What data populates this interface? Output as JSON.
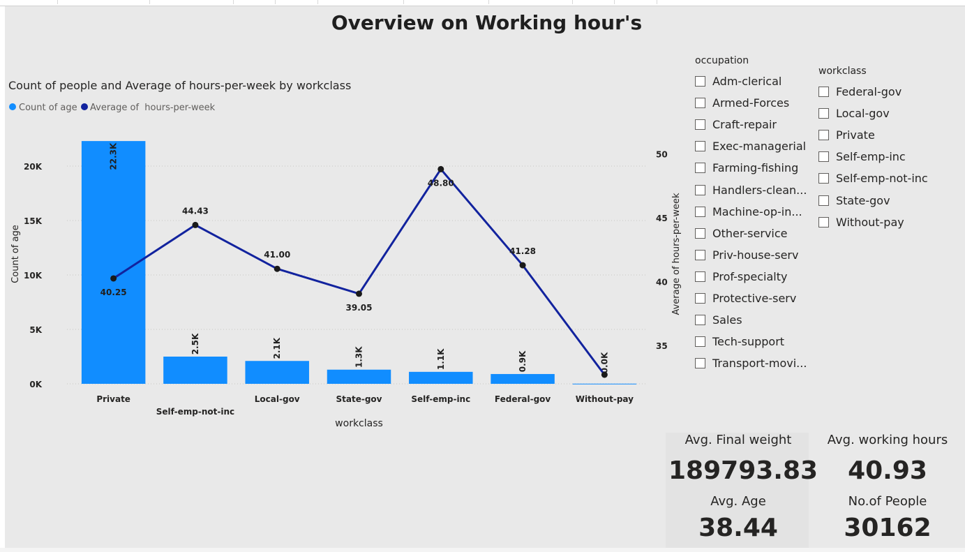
{
  "page_title": "Overview on Working hour's",
  "chart_data": {
    "type": "bar",
    "title": "Count of people and Average of hours-per-week by workclass",
    "categories": [
      "Private",
      "Self-emp-not-inc",
      "Local-gov",
      "State-gov",
      "Self-emp-inc",
      "Federal-gov",
      "Without-pay"
    ],
    "series": [
      {
        "name": "Count of age",
        "type": "bar",
        "axis": "left",
        "color": "#118dff",
        "values": [
          22300,
          2500,
          2100,
          1300,
          1100,
          900,
          14
        ],
        "labels": [
          "22.3K",
          "2.5K",
          "2.1K",
          "1.3K",
          "1.1K",
          "0.9K",
          "0.0K"
        ]
      },
      {
        "name": "Average of  hours-per-week",
        "type": "line",
        "axis": "right",
        "color": "#12239e",
        "values": [
          40.25,
          44.43,
          41.0,
          39.05,
          48.8,
          41.28,
          32.71
        ],
        "labels": [
          "40.25",
          "44.43",
          "41.00",
          "39.05",
          "48.80",
          "41.28",
          ""
        ]
      }
    ],
    "xlabel": "workclass",
    "ylabel": "Count of age",
    "y2label": "Average of hours-per-week",
    "ylim": [
      0,
      25000
    ],
    "y2lim": [
      32,
      53.3
    ],
    "yticks": [
      {
        "v": 0,
        "label": "0K"
      },
      {
        "v": 5000,
        "label": "5K"
      },
      {
        "v": 10000,
        "label": "10K"
      },
      {
        "v": 15000,
        "label": "15K"
      },
      {
        "v": 20000,
        "label": "20K"
      }
    ],
    "y2ticks": [
      {
        "v": 35,
        "label": "35"
      },
      {
        "v": 40,
        "label": "40"
      },
      {
        "v": 45,
        "label": "45"
      },
      {
        "v": 50,
        "label": "50"
      }
    ],
    "grid": true,
    "legend": "top-left"
  },
  "slicers": {
    "occupation": {
      "title": "occupation",
      "items": [
        "Adm-clerical",
        "Armed-Forces",
        "Craft-repair",
        "Exec-managerial",
        "Farming-fishing",
        "Handlers-clean...",
        "Machine-op-in...",
        "Other-service",
        "Priv-house-serv",
        "Prof-specialty",
        "Protective-serv",
        "Sales",
        "Tech-support",
        "Transport-movi..."
      ]
    },
    "workclass": {
      "title": "workclass",
      "items": [
        "Federal-gov",
        "Local-gov",
        "Private",
        "Self-emp-inc",
        "Self-emp-not-inc",
        "State-gov",
        "Without-pay"
      ]
    }
  },
  "cards": {
    "final_weight": {
      "label": "Avg. Final weight",
      "value": "189793.83"
    },
    "working_hours": {
      "label": "Avg. working hours",
      "value": "40.93"
    },
    "age": {
      "label": "Avg. Age",
      "value": "38.44"
    },
    "people": {
      "label": "No.of People",
      "value": "30162"
    }
  }
}
